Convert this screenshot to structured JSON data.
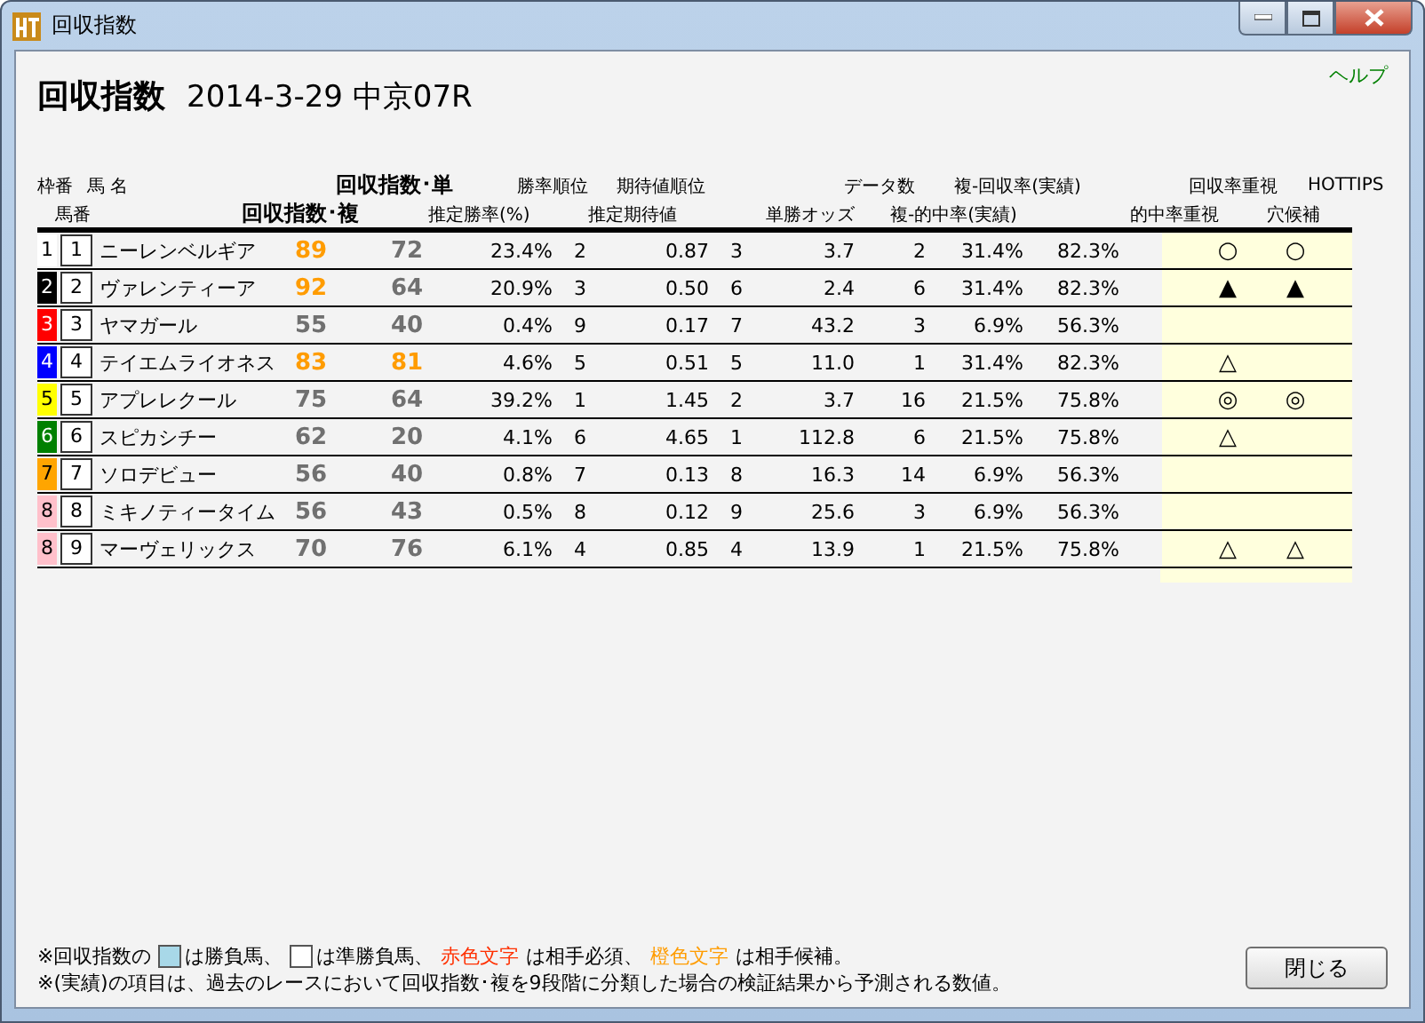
{
  "window": {
    "title": "回収指数"
  },
  "help_link": "ヘルプ",
  "heading": {
    "title": "回収指数",
    "race": "2014-3-29 中京07R"
  },
  "header_row_1": [
    {
      "label": "枠番",
      "kind": "plain"
    },
    {
      "label": "馬 名",
      "kind": "plain"
    },
    {
      "label": "回収指数･単",
      "kind": "bold"
    },
    {
      "label": "勝率順位",
      "kind": "plain"
    },
    {
      "label": "期待値順位",
      "kind": "plain"
    },
    {
      "label": "データ数",
      "kind": "plain"
    },
    {
      "label": "複-回収率(実績)",
      "kind": "plain"
    },
    {
      "label": "回収率重視",
      "kind": "plain"
    },
    {
      "label": "HOTTIPS",
      "kind": "plain"
    }
  ],
  "header_row_2": [
    {
      "label": "馬番",
      "kind": "plain"
    },
    {
      "label": "回収指数･複",
      "kind": "bold"
    },
    {
      "label": "推定勝率(%)",
      "kind": "plain"
    },
    {
      "label": "推定期待値",
      "kind": "plain"
    },
    {
      "label": "単勝オッズ",
      "kind": "plain"
    },
    {
      "label": "複-的中率(実績)",
      "kind": "plain"
    },
    {
      "label": "的中率重視",
      "kind": "plain"
    },
    {
      "label": "穴候補",
      "kind": "plain"
    }
  ],
  "rows": [
    {
      "frame": "1",
      "color": "#ffffff",
      "number": "1",
      "name": "ニーレンベルギア",
      "win_index": "89",
      "win_highlight": true,
      "place_index": "72",
      "place_highlight": false,
      "win_rate": "23.4%",
      "rate_rank": "2",
      "expected": "0.87",
      "expected_rank": "3",
      "odds": "3.7",
      "data_count": "2",
      "hit_rate": "31.4%",
      "return_rate": "82.3%",
      "mark_1": "○",
      "mark_2": "○"
    },
    {
      "frame": "2",
      "color": "#000000",
      "number": "2",
      "name": "ヴァレンティーア",
      "win_index": "92",
      "win_highlight": true,
      "place_index": "64",
      "place_highlight": false,
      "win_rate": "20.9%",
      "rate_rank": "3",
      "expected": "0.50",
      "expected_rank": "6",
      "odds": "2.4",
      "data_count": "6",
      "hit_rate": "31.4%",
      "return_rate": "82.3%",
      "mark_1": "▲",
      "mark_2": "▲"
    },
    {
      "frame": "3",
      "color": "#ff0000",
      "number": "3",
      "name": "ヤマガール",
      "win_index": "55",
      "win_highlight": false,
      "place_index": "40",
      "place_highlight": false,
      "win_rate": "0.4%",
      "rate_rank": "9",
      "expected": "0.17",
      "expected_rank": "7",
      "odds": "43.2",
      "data_count": "3",
      "hit_rate": "6.9%",
      "return_rate": "56.3%"
    },
    {
      "frame": "4",
      "color": "#0000ff",
      "number": "4",
      "name": "テイエムライオネス",
      "win_index": "83",
      "win_highlight": true,
      "place_index": "81",
      "place_highlight": true,
      "win_rate": "4.6%",
      "rate_rank": "5",
      "expected": "0.51",
      "expected_rank": "5",
      "odds": "11.0",
      "data_count": "1",
      "hit_rate": "31.4%",
      "return_rate": "82.3%",
      "mark_1": "△"
    },
    {
      "frame": "5",
      "color": "#ffff00",
      "number": "5",
      "name": "アプレレクール",
      "win_index": "75",
      "win_highlight": false,
      "place_index": "64",
      "place_highlight": false,
      "win_rate": "39.2%",
      "rate_rank": "1",
      "expected": "1.45",
      "expected_rank": "2",
      "odds": "3.7",
      "data_count": "16",
      "hit_rate": "21.5%",
      "return_rate": "75.8%",
      "mark_1": "◎",
      "mark_2": "◎"
    },
    {
      "frame": "6",
      "color": "#008000",
      "number": "6",
      "name": "スピカシチー",
      "win_index": "62",
      "win_highlight": false,
      "place_index": "20",
      "place_highlight": false,
      "win_rate": "4.1%",
      "rate_rank": "6",
      "expected": "4.65",
      "expected_rank": "1",
      "odds": "112.8",
      "data_count": "6",
      "hit_rate": "21.5%",
      "return_rate": "75.8%",
      "mark_1": "△"
    },
    {
      "frame": "7",
      "color": "#ffa500",
      "number": "7",
      "name": "ソロデビュー",
      "win_index": "56",
      "win_highlight": false,
      "place_index": "40",
      "place_highlight": false,
      "win_rate": "0.8%",
      "rate_rank": "7",
      "expected": "0.13",
      "expected_rank": "8",
      "odds": "16.3",
      "data_count": "14",
      "hit_rate": "6.9%",
      "return_rate": "56.3%"
    },
    {
      "frame": "8",
      "color": "#ffc0cb",
      "number": "8",
      "name": "ミキノティータイム",
      "win_index": "56",
      "win_highlight": false,
      "place_index": "43",
      "place_highlight": false,
      "win_rate": "0.5%",
      "rate_rank": "8",
      "expected": "0.12",
      "expected_rank": "9",
      "odds": "25.6",
      "data_count": "3",
      "hit_rate": "6.9%",
      "return_rate": "56.3%"
    },
    {
      "frame": "8",
      "color": "#ffc0cb",
      "number": "9",
      "name": "マーヴェリックス",
      "win_index": "70",
      "win_highlight": false,
      "place_index": "76",
      "place_highlight": false,
      "win_rate": "6.1%",
      "rate_rank": "4",
      "expected": "0.85",
      "expected_rank": "4",
      "odds": "13.9",
      "data_count": "1",
      "hit_rate": "21.5%",
      "return_rate": "75.8%",
      "mark_1": "△",
      "mark_2": "△"
    }
  ],
  "notes": [
    {
      "parts": [
        {
          "text": "※回収指数の",
          "kind": "text"
        },
        {
          "kind": "swatch_blue"
        },
        {
          "text": "は勝負馬、",
          "kind": "text"
        },
        {
          "kind": "swatch_white"
        },
        {
          "text": "は準勝負馬、",
          "kind": "text"
        },
        {
          "text": "赤色文字",
          "kind": "red"
        },
        {
          "text": "は相手必須、",
          "kind": "text"
        },
        {
          "text": "橙色文字",
          "kind": "orange"
        },
        {
          "text": "は相手候補。",
          "kind": "text"
        }
      ]
    },
    {
      "parts": [
        {
          "text": "※(実績)の項目は、過去のレースにおいて回収指数･複を9段階に分類した場合の検証結果から予測される数値。",
          "kind": "text"
        }
      ]
    }
  ],
  "close_button": "閉じる"
}
